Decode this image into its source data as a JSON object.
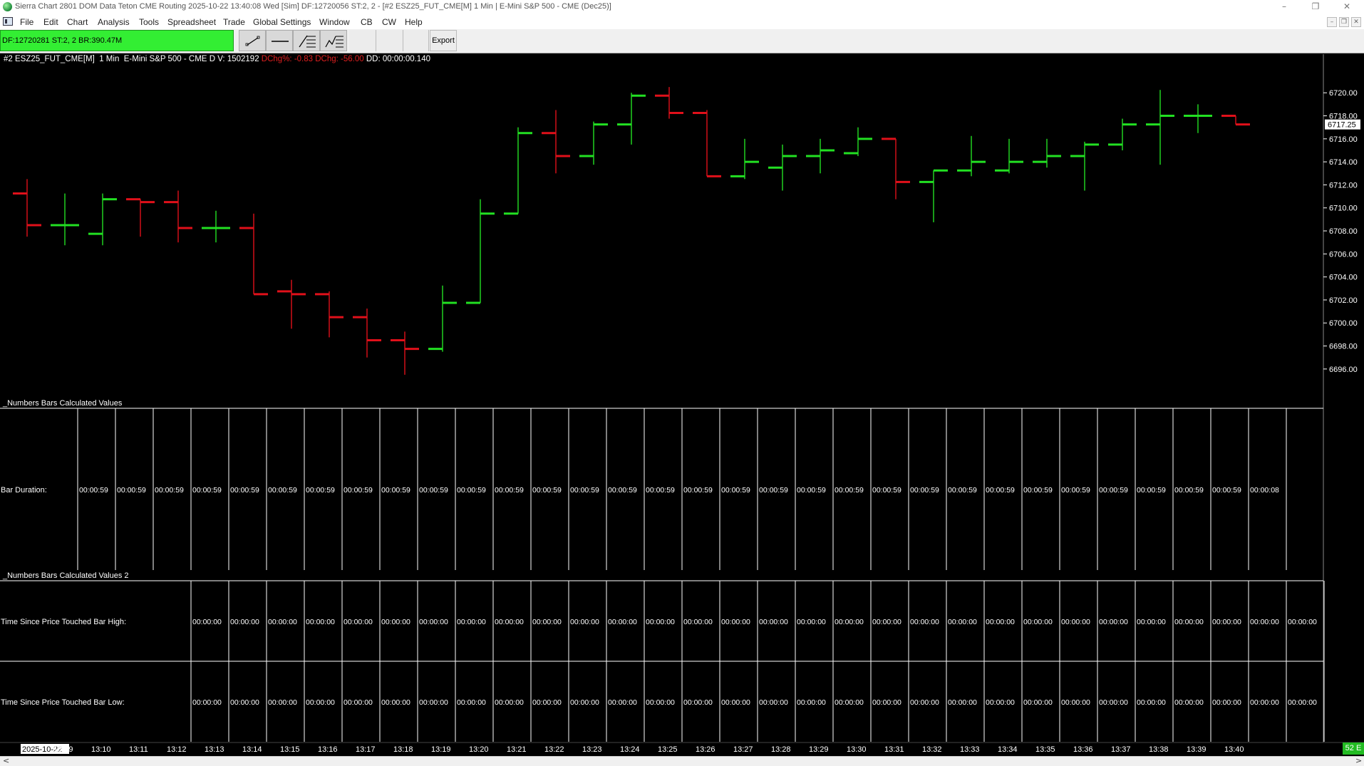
{
  "window": {
    "title": "Sierra Chart 2801 DOM Data Teton CME Routing 2025-10-22  13:40:08 Wed [Sim] DF:12720056  ST:2, 2 - [#2 ESZ25_FUT_CME[M]  1 Min  | E-Mini S&P 500 - CME (Dec25)]",
    "controls": [
      "–",
      "❐",
      "✕"
    ]
  },
  "menu": {
    "items": [
      "File",
      "Edit",
      "Chart",
      "Analysis",
      "Tools",
      "Spreadsheet",
      "Trade",
      "Global Settings",
      "Window",
      "CB",
      "CW",
      "Help"
    ],
    "mdi_controls": [
      "–",
      "❐",
      "✕"
    ]
  },
  "toolbar": {
    "status": "DF:12720281  ST:2, 2  BR:390.47M",
    "export_label": "Export",
    "tools": [
      "line-draw-icon",
      "horizontal-line-icon",
      "fib-retracement-icon",
      "fib-extension-icon"
    ]
  },
  "chart_header": {
    "symbol": "#2 ESZ25_FUT_CME[M]",
    "timeframe": "1 Min",
    "instrument": "E-Mini S&P 500 - CME",
    "dv": "D V: 1502192",
    "dchg_pct": "DChg%: -0.83",
    "dchg": "DChg: -56.00",
    "dd": "DD: 00:00:00.140"
  },
  "colors": {
    "up": "#22e022",
    "down": "#e0101a",
    "grid": "#ffffff",
    "badge": "#22bb22"
  },
  "chart_data": {
    "type": "ohlc",
    "title": "#2 ESZ25_FUT_CME[M]  1 Min  E-Mini S&P 500 - CME",
    "x": [
      "13:08",
      "13:09",
      "13:10",
      "13:11",
      "13:12",
      "13:13",
      "13:14",
      "13:15",
      "13:16",
      "13:17",
      "13:18",
      "13:19",
      "13:20",
      "13:21",
      "13:22",
      "13:23",
      "13:24",
      "13:25",
      "13:26",
      "13:27",
      "13:28",
      "13:29",
      "13:30",
      "13:31",
      "13:32",
      "13:33",
      "13:34",
      "13:35",
      "13:36",
      "13:37",
      "13:38",
      "13:39",
      "13:40"
    ],
    "open": [
      6711.25,
      6708.5,
      6707.75,
      6710.75,
      6710.5,
      6708.25,
      6708.25,
      6702.75,
      6702.5,
      6700.5,
      6698.5,
      6697.75,
      6701.75,
      6709.5,
      6716.5,
      6714.5,
      6717.25,
      6719.75,
      6718.25,
      6712.75,
      6713.5,
      6714.5,
      6714.75,
      6716.0,
      6712.25,
      6713.25,
      6713.25,
      6714.0,
      6714.5,
      6715.5,
      6717.25,
      6718.0,
      6718.0
    ],
    "high": [
      6712.5,
      6711.25,
      6711.25,
      6710.75,
      6711.5,
      6709.75,
      6709.5,
      6703.75,
      6702.75,
      6701.25,
      6699.25,
      6703.25,
      6710.75,
      6717.0,
      6718.5,
      6717.5,
      6720.0,
      6720.5,
      6718.5,
      6716.0,
      6715.5,
      6716.0,
      6717.0,
      6716.0,
      6713.25,
      6716.25,
      6716.0,
      6716.0,
      6715.75,
      6717.75,
      6720.25,
      6719.0,
      6718.0
    ],
    "low": [
      6707.5,
      6706.75,
      6706.75,
      6707.5,
      6707.0,
      6707.0,
      6702.5,
      6699.5,
      6698.75,
      6697.0,
      6695.5,
      6697.5,
      6701.75,
      6709.5,
      6713.0,
      6713.75,
      6715.5,
      6717.75,
      6712.75,
      6712.5,
      6711.5,
      6713.0,
      6714.5,
      6710.75,
      6708.75,
      6712.75,
      6713.0,
      6713.5,
      6711.5,
      6715.0,
      6713.75,
      6716.5,
      6717.25
    ],
    "close": [
      6708.5,
      6708.5,
      6710.75,
      6710.5,
      6708.25,
      6708.25,
      6702.5,
      6702.5,
      6700.5,
      6698.5,
      6697.75,
      6701.75,
      6709.5,
      6716.5,
      6714.5,
      6717.25,
      6719.75,
      6718.25,
      6712.75,
      6714.0,
      6714.5,
      6715.0,
      6716.0,
      6712.25,
      6713.25,
      6714.0,
      6714.0,
      6714.5,
      6715.5,
      6717.25,
      6718.0,
      6718.0,
      6717.25
    ],
    "ylim": [
      6695,
      6721.5
    ],
    "y_ticks": [
      "6720.00",
      "6718.00",
      "6716.00",
      "6714.00",
      "6712.00",
      "6710.00",
      "6708.00",
      "6706.00",
      "6704.00",
      "6702.00",
      "6700.00",
      "6698.00",
      "6696.00"
    ],
    "last_price_label": "6717.25",
    "date_label": "2025-10-22",
    "x_ticks": [
      "13:09",
      "13:10",
      "13:11",
      "13:12",
      "13:13",
      "13:14",
      "13:15",
      "13:16",
      "13:17",
      "13:18",
      "13:19",
      "13:20",
      "13:21",
      "13:22",
      "13:23",
      "13:24",
      "13:25",
      "13:26",
      "13:27",
      "13:28",
      "13:29",
      "13:30",
      "13:31",
      "13:32",
      "13:33",
      "13:34",
      "13:35",
      "13:36",
      "13:37",
      "13:38",
      "13:39",
      "13:40"
    ]
  },
  "study1": {
    "title": "_Numbers Bars Calculated Values",
    "row_label": "Bar Duration:",
    "values": [
      "00:00:59",
      "00:00:59",
      "00:00:59",
      "00:00:59",
      "00:00:59",
      "00:00:59",
      "00:00:59",
      "00:00:59",
      "00:00:59",
      "00:00:59",
      "00:00:59",
      "00:00:59",
      "00:00:59",
      "00:00:59",
      "00:00:59",
      "00:00:59",
      "00:00:59",
      "00:00:59",
      "00:00:59",
      "00:00:59",
      "00:00:59",
      "00:00:59",
      "00:00:59",
      "00:00:59",
      "00:00:59",
      "00:00:59",
      "00:00:59",
      "00:00:59",
      "00:00:59",
      "00:00:59",
      "00:00:59",
      "00:00:08"
    ]
  },
  "study2": {
    "title": "_Numbers Bars Calculated Values 2",
    "row1_label": "Time Since Price Touched Bar High:",
    "row2_label": "Time Since Price Touched Bar Low:",
    "value": "00:00:00",
    "cell_count": 30
  },
  "footer": {
    "badge": "52 E",
    "scroll_left": "<",
    "scroll_right": ">"
  }
}
